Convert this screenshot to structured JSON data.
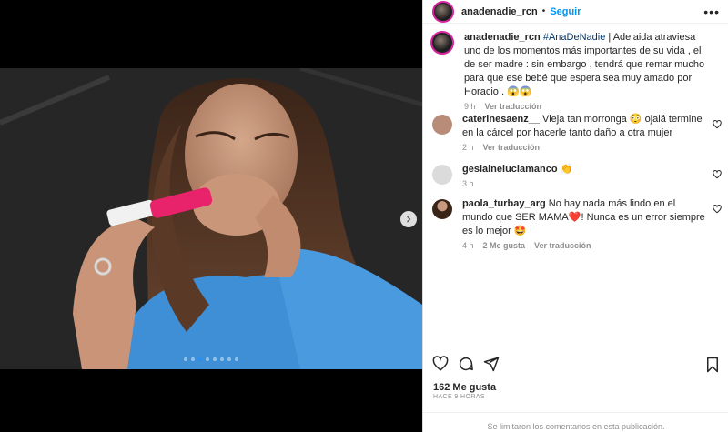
{
  "post": {
    "username": "anadenadie_rcn",
    "separator": "•",
    "follow_label": "Seguir",
    "more_label": "•••",
    "caption": {
      "username": "anadenadie_rcn",
      "hashtag": "#AnaDeNadie",
      "text": " | Adelaida atraviesa uno de los momentos más importantes de su vida , el de ser madre : sin embargo , tendrá que remar mucho para que ese bebé que espera sea muy amado por Horacio . 😱😱",
      "time": "9 h",
      "translate": "Ver traducción"
    },
    "comments": [
      {
        "username": "caterinesaenz__",
        "text": " Vieja tan morronga 😳 ojalá termine en la cárcel por hacerle tanto daño a otra mujer",
        "time": "2 h",
        "likes": "",
        "translate": "Ver traducción",
        "avatar_color": "#b98c7a"
      },
      {
        "username": "geslaineluciamanco",
        "text": " 👏",
        "time": "3 h",
        "likes": "",
        "translate": "",
        "avatar_color": "#dbdbdb"
      },
      {
        "username": "paola_turbay_arg",
        "text": " No hay nada más lindo en el mundo que SER MAMA❤️! Nunca es un error siempre es lo mejor 🤩",
        "time": "4 h",
        "likes": "2 Me gusta",
        "translate": "Ver traducción",
        "avatar_color": "#6b4a3a"
      }
    ],
    "likes_count": "162 Me gusta",
    "posted_ago": "HACE 9 HORAS",
    "comments_disabled": "Se limitaron los comentarios en esta publicación.",
    "carousel": {
      "total": 8,
      "active": 2
    },
    "colors": {
      "accent": "#0095f6",
      "muted": "#8e8e8e",
      "ring": "#d6249f",
      "active_dot": "#2b8df5"
    }
  }
}
